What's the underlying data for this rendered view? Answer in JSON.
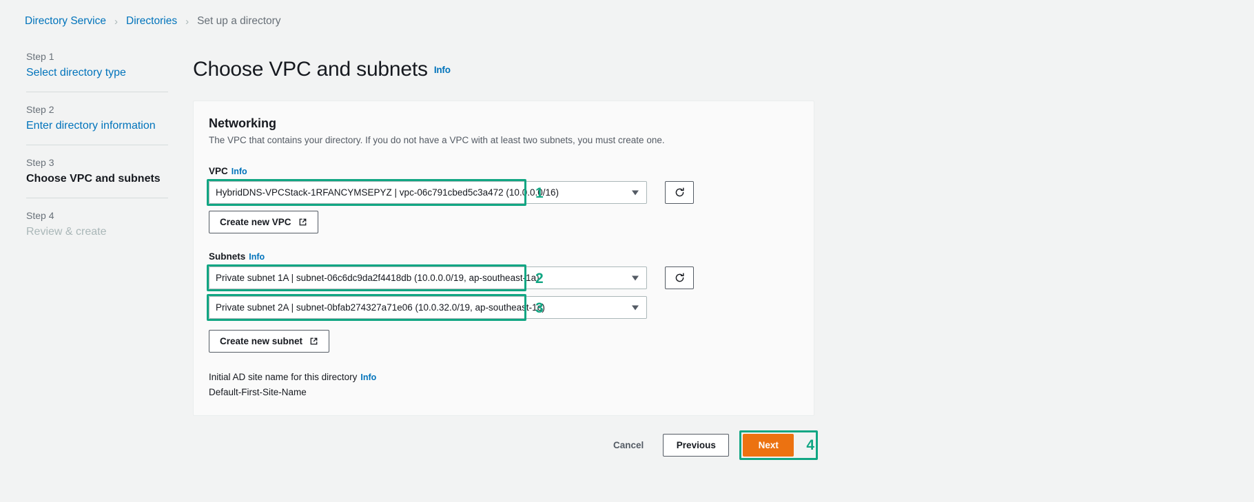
{
  "breadcrumb": {
    "items": [
      {
        "label": "Directory Service",
        "current": false
      },
      {
        "label": "Directories",
        "current": false
      },
      {
        "label": "Set up a directory",
        "current": true
      }
    ],
    "separator": "›"
  },
  "sidebar": {
    "steps": [
      {
        "num": "Step 1",
        "label": "Select directory type",
        "state": "link"
      },
      {
        "num": "Step 2",
        "label": "Enter directory information",
        "state": "link"
      },
      {
        "num": "Step 3",
        "label": "Choose VPC and subnets",
        "state": "current"
      },
      {
        "num": "Step 4",
        "label": "Review & create",
        "state": "disabled"
      }
    ]
  },
  "page": {
    "title": "Choose VPC and subnets",
    "title_info": "Info"
  },
  "card": {
    "title": "Networking",
    "description": "The VPC that contains your directory. If you do not have a VPC with at least two subnets, you must create one.",
    "vpc": {
      "label": "VPC",
      "info": "Info",
      "value": "HybridDNS-VPCStack-1RFANCYMSEPYZ | vpc-06c791cbed5c3a472 (10.0.0.0/16)",
      "annotation": "1",
      "refresh_icon": "refresh-icon"
    },
    "create_vpc_button": {
      "label": "Create new VPC",
      "icon": "external-link-icon"
    },
    "subnets": {
      "label": "Subnets",
      "info": "Info",
      "first": {
        "value": "Private subnet 1A | subnet-06c6dc9da2f4418db (10.0.0.0/19, ap-southeast-1a)",
        "annotation": "2",
        "refresh_icon": "refresh-icon"
      },
      "second": {
        "value": "Private subnet 2A | subnet-0bfab274327a71e06 (10.0.32.0/19, ap-southeast-1c)",
        "annotation": "3"
      }
    },
    "create_subnet_button": {
      "label": "Create new subnet",
      "icon": "external-link-icon"
    },
    "ad_site": {
      "label": "Initial AD site name for this directory",
      "info": "Info",
      "value": "Default-First-Site-Name"
    }
  },
  "actions": {
    "cancel": "Cancel",
    "previous": "Previous",
    "next": "Next",
    "next_annotation": "4"
  },
  "colors": {
    "annotation_green": "#11a683",
    "primary_orange": "#ec7211",
    "link_blue": "#0073bb",
    "page_background": "#f2f3f3",
    "card_background": "#fafafa"
  }
}
